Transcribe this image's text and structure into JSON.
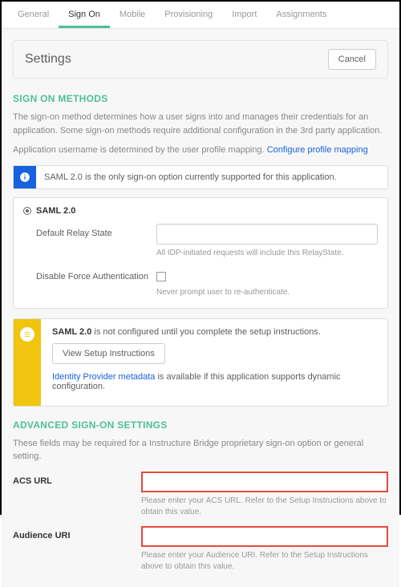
{
  "tabs": {
    "general": "General",
    "signon": "Sign On",
    "mobile": "Mobile",
    "provisioning": "Provisioning",
    "import": "Import",
    "assignments": "Assignments"
  },
  "header": {
    "title": "Settings",
    "cancel": "Cancel"
  },
  "signOnMethods": {
    "title": "SIGN ON METHODS",
    "desc1": "The sign-on method determines how a user signs into and manages their credentials for an application. Some sign-on methods require additional configuration in the 3rd party application.",
    "desc2a": "Application username is determined by the user profile mapping. ",
    "configLink": "Configure profile mapping",
    "banner": "SAML 2.0 is the only sign-on option currently supported for this application.",
    "samlLabel": "SAML 2.0",
    "relay": {
      "label": "Default Relay State",
      "hint": "All IDP-initiated requests will include this RelayState."
    },
    "disableForce": {
      "label": "Disable Force Authentication",
      "hint": "Never prompt user to re-authenticate."
    }
  },
  "setup": {
    "boldPart": "SAML 2.0",
    "text": " is not configured until you complete the setup instructions.",
    "button": "View Setup Instructions",
    "idpLink": "Identity Provider metadata",
    "idpText": " is available if this application supports dynamic configuration."
  },
  "advanced": {
    "title": "ADVANCED SIGN-ON SETTINGS",
    "desc": "These fields may be required for a Instructure Bridge proprietary sign-on option or general setting.",
    "acs": {
      "label": "ACS URL",
      "hint": "Please enter your ACS URL. Refer to the Setup Instructions above to obtain this value."
    },
    "audience": {
      "label": "Audience URI",
      "hint": "Please enter your Audience URI. Refer to the Setup Instructions above to obtain this value."
    }
  }
}
